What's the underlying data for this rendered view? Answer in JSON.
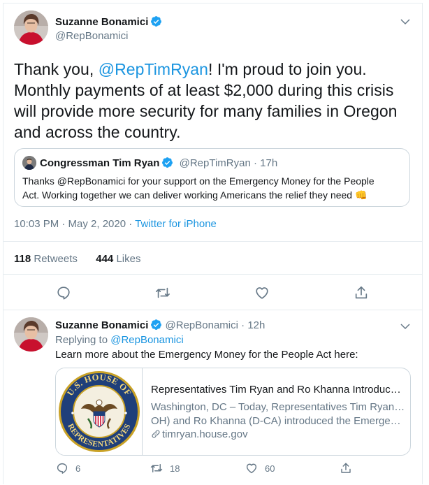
{
  "main_tweet": {
    "author_name": "Suzanne Bonamici",
    "author_handle": "@RepBonamici",
    "text_prefix": "Thank you, ",
    "mention": "@RepTimRyan",
    "text_line1_rest": "! I'm proud to join you.",
    "text_line2": "Monthly payments of at least $2,000 during this crisis",
    "text_line3": "will provide more security for many families in Oregon",
    "text_line4": "and across the country.",
    "quoted": {
      "author_name": "Congressman Tim Ryan",
      "author_handle": "@RepTimRyan",
      "separator": "·",
      "time": "17h",
      "line1": "Thanks @RepBonamici for your support on the Emergency Money for the People",
      "line2": "Act. Working together we can deliver working Americans the relief they need",
      "emoji": "👊"
    },
    "timestamp": "10:03 PM · May 2, 2020 · ",
    "source": "Twitter for iPhone",
    "retweets_count": "118",
    "retweets_label": "Retweets",
    "likes_count": "444",
    "likes_label": "Likes"
  },
  "reply_tweet": {
    "author_name": "Suzanne Bonamici",
    "author_handle": "@RepBonamici",
    "separator": "·",
    "time": "12h",
    "replying_label": "Replying to ",
    "replying_to": "@RepBonamici",
    "text": "Learn more about the Emergency Money for the People Act here:",
    "card": {
      "title": "Representatives Tim Ryan and Ro Khanna Introduce ...",
      "desc_line1": "Washington, DC – Today, Representatives Tim Ryan (D-",
      "desc_line2": "OH) and Ro Khanna (D-CA) introduced the Emergenc...",
      "domain": "timryan.house.gov",
      "seal_top_text": "U.S. HOUSE OF",
      "seal_bottom_text": "REPRESENTATIVES"
    },
    "reply_count": "6",
    "retweet_count": "18",
    "like_count": "60"
  },
  "colors": {
    "accent": "#1b95e0",
    "secondary_text": "#657786",
    "border": "#e6ecf0",
    "seal_navy": "#1f3f7a",
    "seal_gold": "#c9a227"
  },
  "icons": [
    "verified-badge-icon",
    "chevron-down-icon",
    "reply-icon",
    "retweet-icon",
    "like-icon",
    "share-icon",
    "link-icon"
  ]
}
